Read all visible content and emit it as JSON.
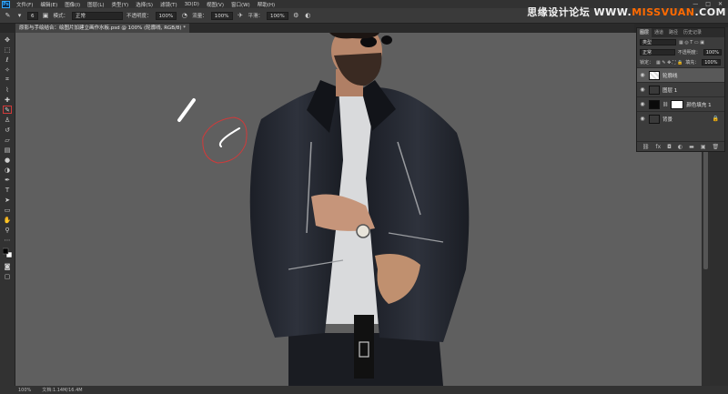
{
  "menubar": {
    "logo": "Ps",
    "items": [
      "文件(F)",
      "编辑(E)",
      "图像(I)",
      "图层(L)",
      "类型(Y)",
      "选择(S)",
      "滤镜(T)",
      "3D(D)",
      "视图(V)",
      "窗口(W)",
      "帮助(H)"
    ]
  },
  "window_controls": {
    "minimize": "—",
    "maximize": "□",
    "close": "✕"
  },
  "watermark": {
    "text": "思缘设计论坛",
    "suffix_a": " WWW.",
    "suffix_b": "MISSVUAN",
    "suffix_c": ".COM"
  },
  "options": {
    "brush_size": "6",
    "mode_label": "模式：",
    "mode_value": "正常",
    "opacity_label": "不透明度：",
    "opacity_value": "100%",
    "flow_label": "流量：",
    "flow_value": "100%",
    "smooth_label": "平滑：",
    "smooth_value": "100%"
  },
  "document_tab": {
    "title": "原影与手绘结合：绘图片加建立画作水板.psd @ 100% (轮廓线, RGB/8) *"
  },
  "statusbar": {
    "zoom": "100%",
    "doc_info": "文档:1.14M/16.4M"
  },
  "layers_panel": {
    "tabs": [
      "图层",
      "通道",
      "路径",
      "历史记录"
    ],
    "kind_label": "类型",
    "blend_mode": "正常",
    "opacity_label": "不透明度：",
    "opacity_value": "100%",
    "lock_label": "锁定：",
    "fill_label": "填充：",
    "fill_value": "100%",
    "layers": [
      {
        "name": "轮廓线",
        "selected": true
      },
      {
        "name": "图层 1",
        "selected": false
      },
      {
        "name": "颜色填充 1",
        "selected": false
      },
      {
        "name": "背景",
        "selected": false
      }
    ]
  },
  "colors": {
    "accent_red": "#d13a3a",
    "panel": "#3c3c3c",
    "canvas": "#5c5c5c",
    "ps_blue": "#31a8ff"
  }
}
